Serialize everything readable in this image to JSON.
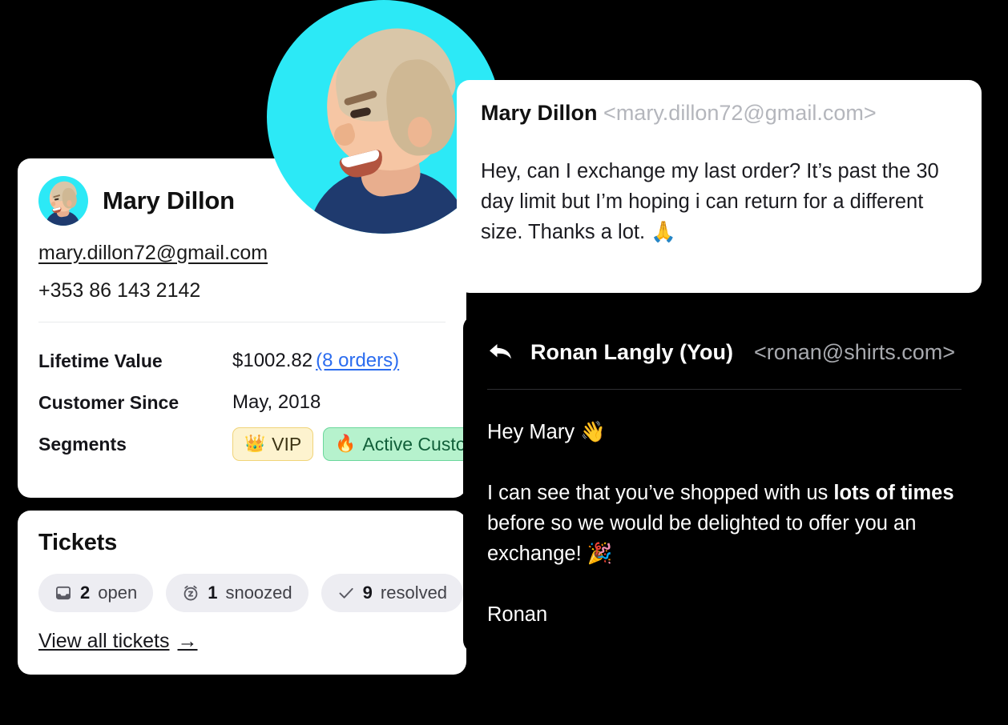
{
  "customer_card": {
    "name": "Mary Dillon",
    "email": "mary.dillon72@gmail.com",
    "phone": "+353 86 143 2142",
    "details": [
      {
        "label": "Lifetime Value",
        "value": "$1002.82",
        "link": "(8 orders)"
      },
      {
        "label": "Customer Since",
        "value": "May, 2018"
      },
      {
        "label": "Segments"
      }
    ],
    "segments": [
      {
        "emoji": "👑",
        "label": "VIP"
      },
      {
        "emoji": "🔥",
        "label": "Active Customer"
      }
    ]
  },
  "tickets_card": {
    "title": "Tickets",
    "pills": [
      {
        "icon": "inbox-icon",
        "count": "2",
        "label": "open"
      },
      {
        "icon": "snooze-clock-icon",
        "count": "1",
        "label": "snoozed"
      },
      {
        "icon": "check-icon",
        "count": "9",
        "label": "resolved"
      }
    ],
    "view_all": "View all tickets",
    "view_all_arrow": "→"
  },
  "incoming_message": {
    "sender_name": "Mary Dillon",
    "sender_email": "<mary.dillon72@gmail.com>",
    "body": "Hey, can I exchange my last order? It’s past the 30 day limit but I’m hoping i can return for a different size. Thanks a lot. 🙏"
  },
  "reply_message": {
    "reply_icon": "reply-arrow-icon",
    "sender_name": "Ronan Langly (You)",
    "sender_email": "<ronan@shirts.com>",
    "greeting": "Hey Mary 👋",
    "paragraph_pre": "I can see that you’ve shopped with us ",
    "paragraph_bold": "lots of times",
    "paragraph_post": " before so we would be delighted to offer you an exchange! 🎉",
    "signature": "Ronan"
  },
  "colors": {
    "page_background": "#000000",
    "accent_cyan": "#2CE9F6",
    "link_blue": "#2B6CEF",
    "vip_pill_background": "#FDF3CF",
    "active_pill_background": "#B6F2CD",
    "card_white": "#FFFFFF"
  }
}
